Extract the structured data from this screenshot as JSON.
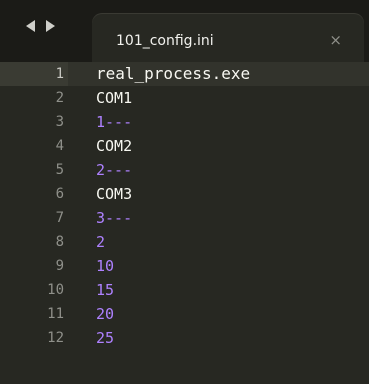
{
  "tabbar": {
    "tab_label": "101_config.ini",
    "close_glyph": "×"
  },
  "colors": {
    "background": "#272822",
    "text": "#f8f8f2",
    "number": "#ae81ff",
    "gutter": "#8f908a"
  },
  "editor": {
    "lines": [
      {
        "number": "1",
        "text": "real_process.exe"
      },
      {
        "number": "2",
        "text": "COM1"
      },
      {
        "number": "3",
        "text": "1---"
      },
      {
        "number": "4",
        "text": "COM2"
      },
      {
        "number": "5",
        "text": "2---"
      },
      {
        "number": "6",
        "text": "COM3"
      },
      {
        "number": "7",
        "text": "3---"
      },
      {
        "number": "8",
        "text": "2"
      },
      {
        "number": "9",
        "text": "10"
      },
      {
        "number": "10",
        "text": "15"
      },
      {
        "number": "11",
        "text": "20"
      },
      {
        "number": "12",
        "text": "25"
      }
    ]
  }
}
